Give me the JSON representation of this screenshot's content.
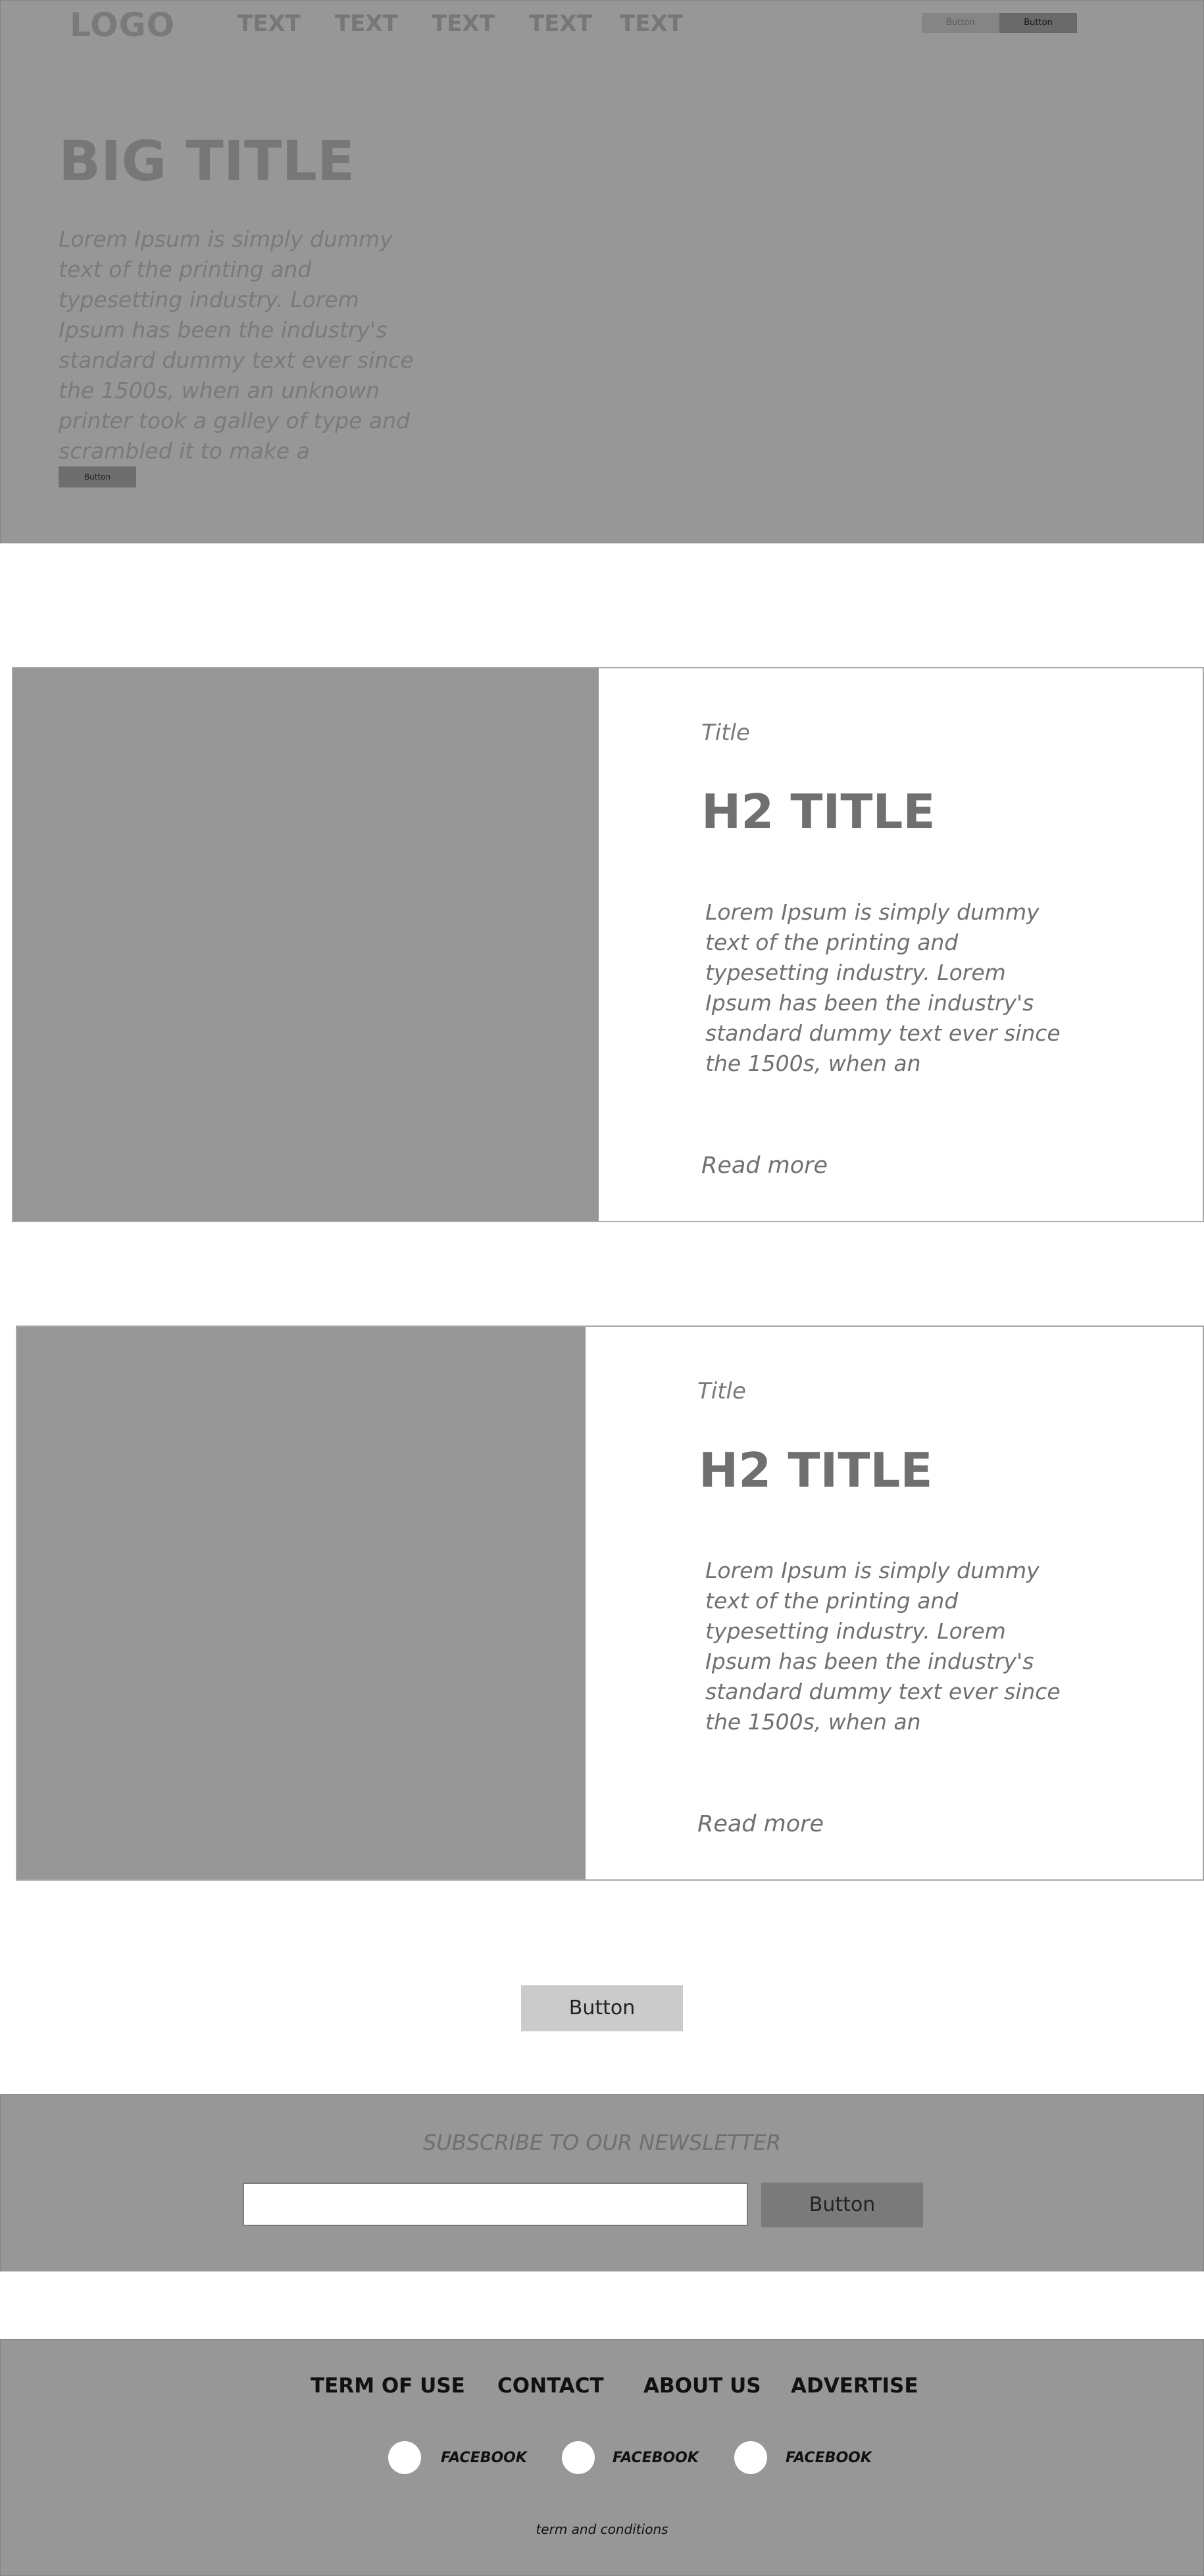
{
  "header": {
    "logo": "LOGO",
    "nav": [
      "TEXT",
      "TEXT",
      "TEXT",
      "TEXT",
      "TEXT"
    ],
    "buttons": [
      "Button",
      "Button"
    ]
  },
  "hero": {
    "title": "BIG TITLE",
    "text": "Lorem Ipsum is simply dummy text of the printing and typesetting industry. Lorem Ipsum has been the industry's standard dummy text ever since the 1500s, when an unknown printer took a galley of type and scrambled it to make a",
    "button": "Button"
  },
  "cards": [
    {
      "small_title": "Title",
      "h2": "H2 TITLE",
      "text": "Lorem Ipsum is simply dummy text of the printing and typesetting industry. Lorem Ipsum has been the industry's standard dummy text ever since the 1500s, when an",
      "read_more": "Read more"
    },
    {
      "small_title": "Title",
      "h2": "H2 TITLE",
      "text": "Lorem Ipsum is simply dummy text of the printing and typesetting industry. Lorem Ipsum has been the industry's standard dummy text ever since the 1500s, when an",
      "read_more": "Read more"
    }
  ],
  "center_button": "Button",
  "newsletter": {
    "title": "SUBSCRIBE TO OUR NEWSLETTER",
    "input_value": "",
    "button": "Button"
  },
  "footer": {
    "links": [
      "TERM OF USE",
      "CONTACT",
      "ABOUT US",
      "ADVERTISE"
    ],
    "social": [
      "FACEBOOK",
      "FACEBOOK",
      "FACEBOOK"
    ],
    "terms": "term and conditions"
  },
  "colors": {
    "gray_block": "#979797",
    "dark_button": "#6e6e6e",
    "light_button": "#cbcbcb"
  }
}
